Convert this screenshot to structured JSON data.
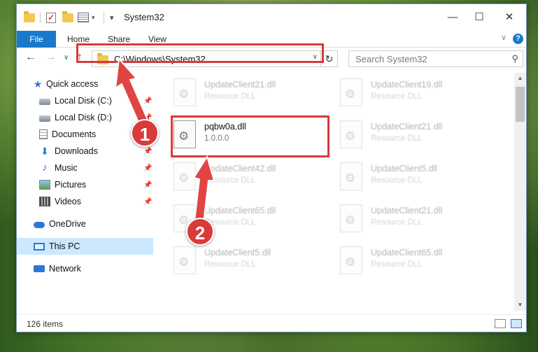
{
  "window": {
    "title": "System32",
    "controls": {
      "minimize": "—",
      "maximize": "☐",
      "close": "✕"
    }
  },
  "ribbon": {
    "file_tab": "File",
    "tabs": [
      "Home",
      "Share",
      "View"
    ],
    "help": "?",
    "collapse": "∨"
  },
  "nav": {
    "back": "←",
    "forward": "→",
    "recent": "∨",
    "up": "↑",
    "address": "C:\\Windows\\System32",
    "address_dropdown": "∨",
    "refresh": "↻",
    "search_placeholder": "Search System32",
    "search_icon": "⚲"
  },
  "sidebar": {
    "items": [
      {
        "label": "Quick access",
        "icon": "star-icon"
      },
      {
        "label": "Local Disk (C:)",
        "icon": "disk-icon",
        "pinned": true
      },
      {
        "label": "Local Disk (D:)",
        "icon": "disk-icon",
        "pinned": true
      },
      {
        "label": "Documents",
        "icon": "documents-icon",
        "pinned": true
      },
      {
        "label": "Downloads",
        "icon": "download-icon",
        "pinned": true
      },
      {
        "label": "Music",
        "icon": "music-icon",
        "pinned": true
      },
      {
        "label": "Pictures",
        "icon": "pictures-icon",
        "pinned": true
      },
      {
        "label": "Videos",
        "icon": "videos-icon",
        "pinned": true
      },
      {
        "label": "OneDrive",
        "icon": "cloud-icon"
      },
      {
        "label": "This PC",
        "icon": "computer-icon",
        "selected": true
      },
      {
        "label": "Network",
        "icon": "network-icon"
      }
    ],
    "pin_glyph": "📌"
  },
  "files": [
    {
      "name": "UpdateClient21.dll",
      "sub": "Resource DLL"
    },
    {
      "name": "UpdateClient19.dll",
      "sub": "Resource DLL"
    },
    {
      "name": "pqbw0a.dll",
      "sub": "1.0.0.0",
      "focused": true
    },
    {
      "name": "UpdateClient21.dll",
      "sub": "Resource DLL"
    },
    {
      "name": "UpdateClient42.dll",
      "sub": "Resource DLL"
    },
    {
      "name": "UpdateClient5.dll",
      "sub": "Resource DLL"
    },
    {
      "name": "UpdateClient65.dll",
      "sub": "Resource DLL"
    },
    {
      "name": "UpdateClient21.dll",
      "sub": "Resource DLL"
    },
    {
      "name": "UpdateClient5.dll",
      "sub": "Resource DLL"
    },
    {
      "name": "UpdateClient65.dll",
      "sub": "Resource DLL"
    }
  ],
  "status": {
    "item_count": "126 items"
  },
  "callouts": [
    "1",
    "2"
  ],
  "colors": {
    "accent": "#1979ca",
    "highlight_red": "#d93a3a",
    "selection": "#cce8ff"
  }
}
